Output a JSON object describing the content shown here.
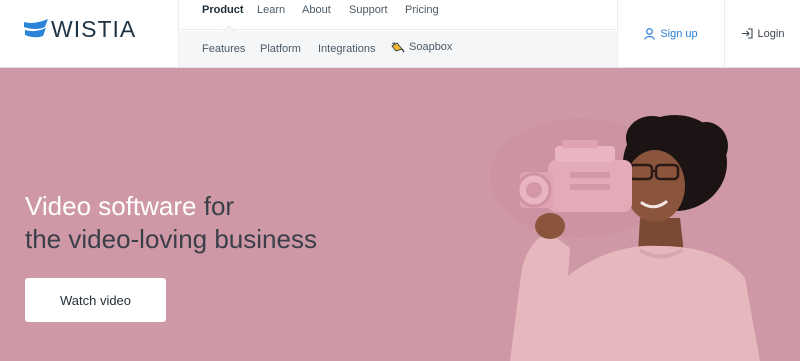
{
  "brand": {
    "name": "WISTIA"
  },
  "nav": {
    "primary": [
      {
        "label": "Product",
        "active": true
      },
      {
        "label": "Learn"
      },
      {
        "label": "About"
      },
      {
        "label": "Support"
      },
      {
        "label": "Pricing"
      }
    ],
    "secondary": [
      {
        "label": "Features"
      },
      {
        "label": "Platform"
      },
      {
        "label": "Integrations"
      },
      {
        "label": "Soapbox",
        "icon": "soapbox-megaphone-icon"
      }
    ]
  },
  "auth": {
    "signup": {
      "label": "Sign up",
      "icon": "user-icon"
    },
    "login": {
      "label": "Login",
      "icon": "login-arrow-icon"
    }
  },
  "hero": {
    "title_light": "Video software",
    "title_dark_1": "for",
    "title_dark_2": "the video-loving business",
    "cta_label": "Watch video",
    "background": "#cf98a6"
  },
  "colors": {
    "brand_blue": "#2b7dd6",
    "heading_dark": "#3a3f4a",
    "nav_text": "#4a5966"
  }
}
